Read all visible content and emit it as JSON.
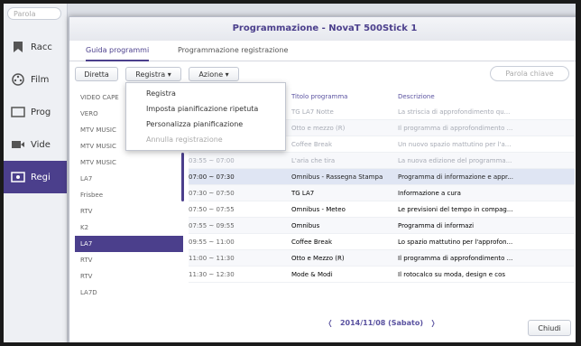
{
  "app": {
    "search_placeholder": "Parola",
    "sidebar": [
      {
        "label": "Racc",
        "icon": "bookmark-icon"
      },
      {
        "label": "Film",
        "icon": "film-icon"
      },
      {
        "label": "Prog",
        "icon": "tv-icon"
      },
      {
        "label": "Vide",
        "icon": "video-icon"
      },
      {
        "label": "Regi",
        "icon": "record-icon",
        "active": true
      }
    ]
  },
  "dialog": {
    "title": "Programmazione - NovaT 500Stick 1",
    "tabs": [
      "Guida programmi",
      "Programmazione registrazione"
    ],
    "toolbar": {
      "diretta": "Diretta",
      "registra": "Registra ▾",
      "azione": "Azione ▾",
      "search_placeholder": "Parola chiave"
    },
    "menu": {
      "items": [
        {
          "label": "Registra",
          "enabled": true
        },
        {
          "label": "Imposta pianificazione ripetuta",
          "enabled": true
        },
        {
          "label": "Personalizza pianificazione",
          "enabled": true
        },
        {
          "label": "Annulla registrazione",
          "enabled": false
        }
      ]
    },
    "channels": [
      "VIDEO CAPE",
      "VERO",
      "MTV MUSIC",
      "MTV MUSIC",
      "MTV MUSIC",
      "LA7",
      "Frisbee",
      "RTV",
      "K2",
      "LA7",
      "RTV",
      "RTV",
      "LA7D"
    ],
    "selected_channel_index": 9,
    "table": {
      "headers": [
        "Titolo programma",
        "Descrizione"
      ],
      "rows": [
        {
          "time": "",
          "title": "TG LA7 Notte",
          "desc": "La striscia di approfondimento qu...",
          "state": "past"
        },
        {
          "time": "",
          "title": "Otto e mezzo (R)",
          "desc": "Il programma di approfondimento ...",
          "state": "past"
        },
        {
          "time": "",
          "title": "Coffee Break",
          "desc": "Un nuovo spazio mattutino per l'a...",
          "state": "past"
        },
        {
          "time": "03:55 ~ 07:00",
          "title": "L'aria che tira",
          "desc": "La nuova edizione del programma...",
          "state": "past"
        },
        {
          "time": "07:00 ~ 07:30",
          "title": "Omnibus - Rassegna Stampa",
          "desc": "Programma di informazione e appr...",
          "state": "current"
        },
        {
          "time": "07:30 ~ 07:50",
          "title": "TG LA7",
          "desc": "Informazione a cura",
          "state": "future"
        },
        {
          "time": "07:50 ~ 07:55",
          "title": "Omnibus - Meteo",
          "desc": "Le previsioni del tempo in compag...",
          "state": "future"
        },
        {
          "time": "07:55 ~ 09:55",
          "title": "Omnibus",
          "desc": "Programma di informazi",
          "state": "future"
        },
        {
          "time": "09:55 ~ 11:00",
          "title": "Coffee Break",
          "desc": "Lo spazio mattutino per l'approfon...",
          "state": "future"
        },
        {
          "time": "11:00 ~ 11:30",
          "title": "Otto e Mezzo (R)",
          "desc": "Il programma di approfondimento ...",
          "state": "future"
        },
        {
          "time": "11:30 ~ 12:30",
          "title": "Mode & Modi",
          "desc": "Il rotocalco su moda, design e cos",
          "state": "future"
        }
      ]
    },
    "date_nav": {
      "prev": "❬",
      "date": "2014/11/08 (Sabato)",
      "next": "❭"
    },
    "close_label": "Chiudi"
  },
  "colors": {
    "accent": "#4b3f8c",
    "highlight_row": "#dfe5f3"
  }
}
